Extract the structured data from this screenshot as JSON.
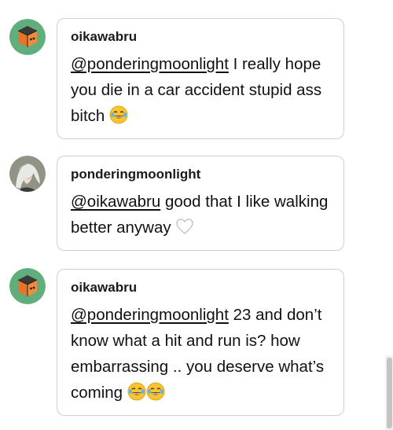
{
  "replies": [
    {
      "author": "oikawabru",
      "avatar_icon": "orange-cube-avatar-icon",
      "mention": "@ponderingmoonlight",
      "text": "I really hope you die in a car accident stupid ass bitch",
      "emojis": [
        "tears-of-joy-emoji"
      ]
    },
    {
      "author": "ponderingmoonlight",
      "avatar_icon": "white-haired-character-avatar-icon",
      "mention": "@oikawabru",
      "text": "good that I like walking better anyway",
      "emojis": [
        "white-heart-emoji"
      ]
    },
    {
      "author": "oikawabru",
      "avatar_icon": "orange-cube-avatar-icon",
      "mention": "@ponderingmoonlight",
      "text": "23 and don’t know what a hit and run is? how embarrassing .. you deserve what’s coming",
      "emojis": [
        "tears-of-joy-emoji",
        "tears-of-joy-emoji"
      ]
    }
  ],
  "colors": {
    "cube_avatar_bg": "#5fae7c",
    "cube_orange": "#e8732a",
    "bubble_border": "#cfcfcf"
  }
}
